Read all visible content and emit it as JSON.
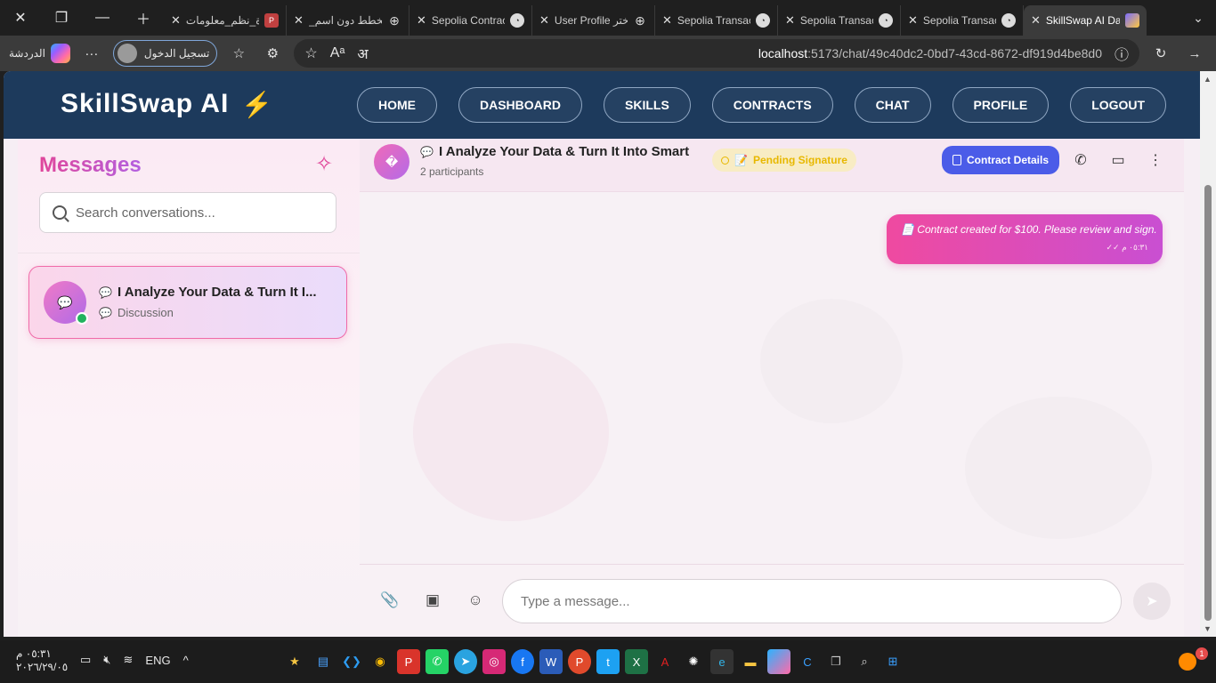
{
  "browser": {
    "tabs": [
      {
        "label": "ادارة_نظم_معلومات",
        "icon": "pdf-icon"
      },
      {
        "label": "_مخطط دون اسم",
        "icon": "globe-icon"
      },
      {
        "label": "Sepolia Contract",
        "icon": "etherscan-icon"
      },
      {
        "label": "User Profile اختر",
        "icon": "globe-icon"
      },
      {
        "label": "Sepolia Transact",
        "icon": "etherscan-icon"
      },
      {
        "label": "Sepolia Transact",
        "icon": "etherscan-icon"
      },
      {
        "label": "Sepolia Transact",
        "icon": "etherscan-icon"
      },
      {
        "label": "SkillSwap AI Da",
        "icon": "vite-icon",
        "active": true
      }
    ],
    "chat_label": "الدردشة",
    "login_label": "تسجيل الدخول",
    "url_host": "localhost",
    "url_rest": ":5173/chat/49c40dc2-0bd7-43cd-8672-df919d4be8d0"
  },
  "app": {
    "brand": "SkillSwap AI",
    "nav": [
      "HOME",
      "DASHBOARD",
      "SKILLS",
      "CONTRACTS",
      "CHAT",
      "PROFILE",
      "LOGOUT"
    ]
  },
  "sidebar": {
    "title": "Messages",
    "search_placeholder": "Search conversations...",
    "conversations": [
      {
        "title": "I Analyze Your Data & Turn It I...",
        "subtitle": "Discussion",
        "online": true
      }
    ]
  },
  "chat": {
    "title": "I Analyze Your Data & Turn It Into Smart",
    "participants": "2 participants",
    "status": "Pending Signature",
    "status_emoji": "📝",
    "contract_button": "Contract Details",
    "avatar_glyph": "�",
    "messages": [
      {
        "text": "📄 Contract created for $100. Please review and sign.",
        "time": "٠٥:٣١ م",
        "read": "✓✓"
      }
    ],
    "composer_placeholder": "Type a message..."
  },
  "taskbar": {
    "time": "٠٥:٣١ م",
    "date": "٢٠٢٦/٢٩/٠٥",
    "language": "ENG",
    "notification_count": "1"
  },
  "colors": {
    "nav_bg": "#1d3a5c",
    "accent_pink": "#ef4aa0",
    "accent_purple": "#c94fd2",
    "contract_button": "#4b5ce8",
    "pending_badge": "#e8b800",
    "online": "#22b35e"
  }
}
